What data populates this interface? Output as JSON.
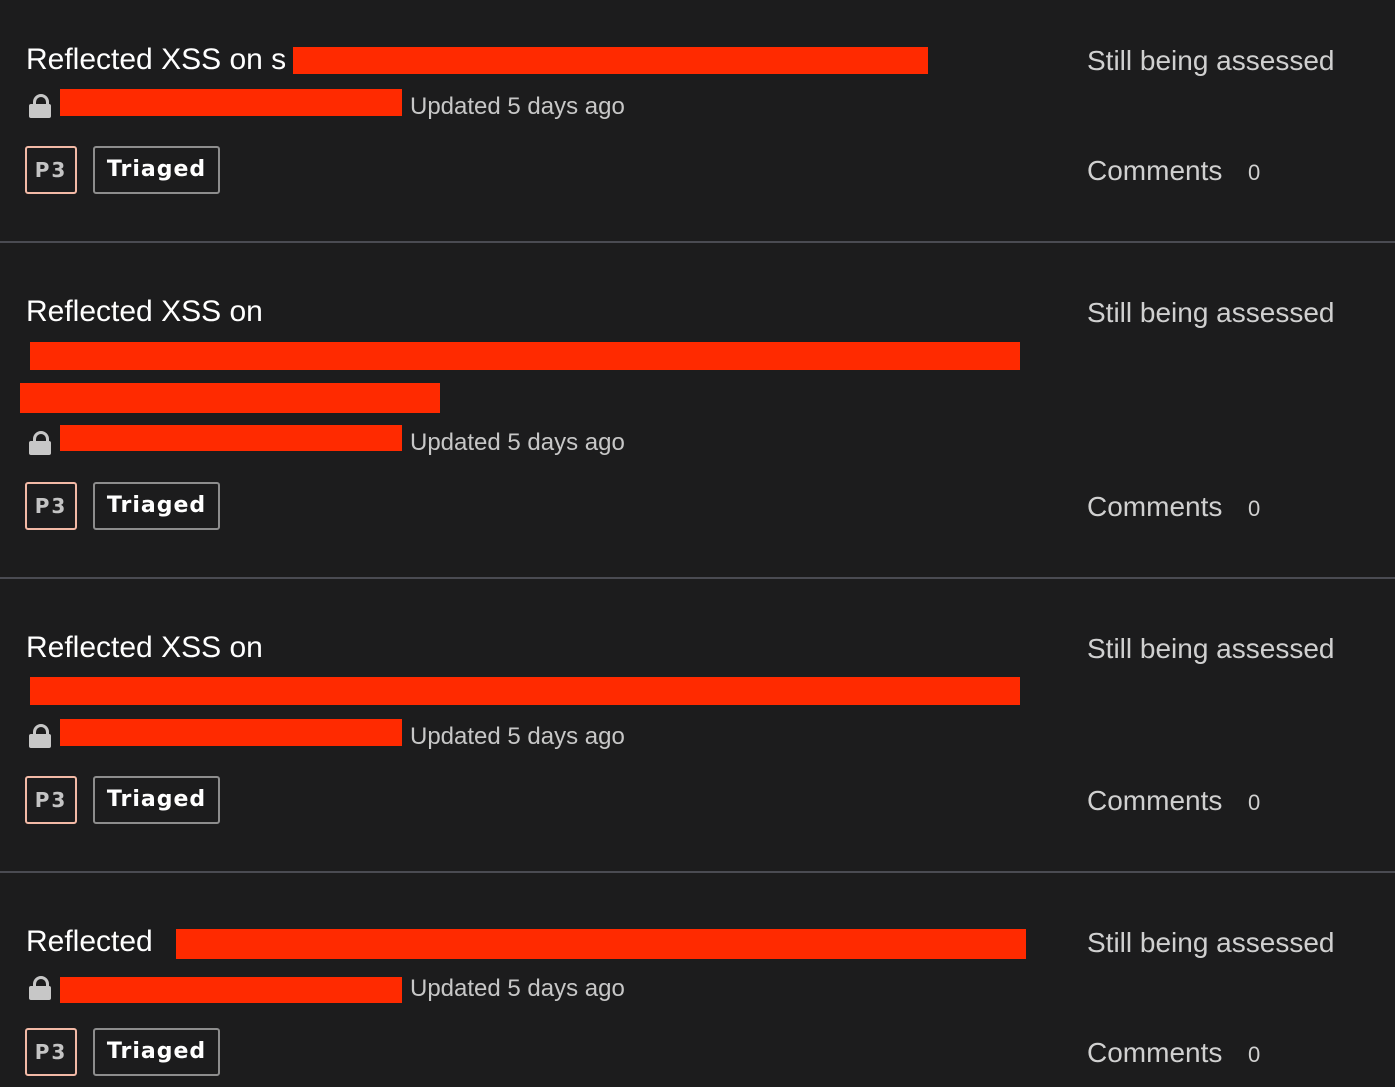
{
  "reports": [
    {
      "title_visible": "Reflected XSS on s",
      "updated": "Updated 5 days ago",
      "priority": "P3",
      "state": "Triaged",
      "status": "Still being assessed",
      "comments_label": "Comments",
      "comments_count": "0"
    },
    {
      "title_visible": "Reflected XSS on",
      "updated": "Updated 5 days ago",
      "priority": "P3",
      "state": "Triaged",
      "status": "Still being assessed",
      "comments_label": "Comments",
      "comments_count": "0"
    },
    {
      "title_visible": "Reflected XSS on",
      "updated": "Updated 5 days ago",
      "priority": "P3",
      "state": "Triaged",
      "status": "Still being assessed",
      "comments_label": "Comments",
      "comments_count": "0"
    },
    {
      "title_visible": "Reflected",
      "updated": "Updated 5 days ago",
      "priority": "P3",
      "state": "Triaged",
      "status": "Still being assessed",
      "comments_label": "Comments",
      "comments_count": "0"
    }
  ],
  "icons": {
    "private": "lock-icon"
  },
  "colors": {
    "background": "#1c1c1d",
    "redaction": "#ff2a00",
    "priority_border": "#f2b9a6",
    "divider": "#4a4b52"
  }
}
